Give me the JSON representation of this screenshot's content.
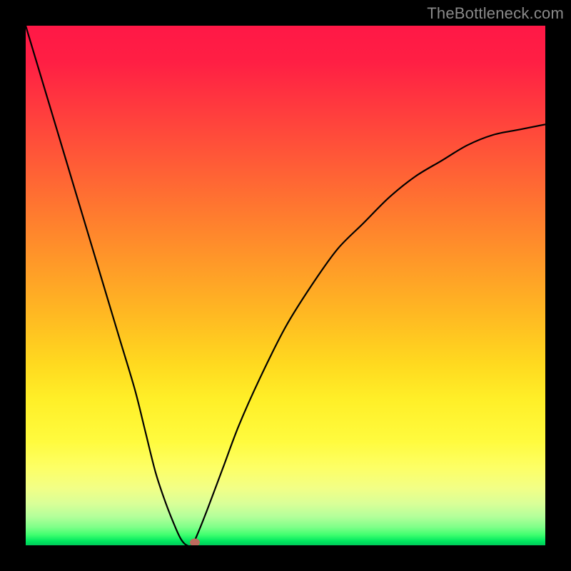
{
  "watermark": "TheBottleneck.com",
  "colors": {
    "background": "#000000",
    "curve": "#000000",
    "marker": "#bd6b5e"
  },
  "chart_data": {
    "type": "line",
    "title": "",
    "xlabel": "",
    "ylabel": "",
    "xlim": [
      0,
      100
    ],
    "ylim": [
      0,
      100
    ],
    "grid": false,
    "series": [
      {
        "name": "bottleneck-curve",
        "x": [
          0,
          3,
          6,
          9,
          12,
          15,
          18,
          21,
          23,
          25,
          27,
          29,
          30,
          31,
          32,
          33,
          35,
          38,
          41,
          45,
          50,
          55,
          60,
          65,
          70,
          75,
          80,
          85,
          90,
          95,
          100
        ],
        "values": [
          100,
          90,
          80,
          70,
          60,
          50,
          40,
          30,
          22,
          14,
          8,
          3,
          1,
          0,
          0,
          2,
          7,
          15,
          23,
          32,
          42,
          50,
          57,
          62,
          67,
          71,
          74,
          77,
          79,
          80,
          81
        ]
      }
    ],
    "marker": {
      "x": 32.5,
      "y": 0.5
    },
    "gradient_stops": [
      {
        "pos": 0.0,
        "color": "#ff1846"
      },
      {
        "pos": 0.36,
        "color": "#ff7a2f"
      },
      {
        "pos": 0.65,
        "color": "#ffd91f"
      },
      {
        "pos": 0.85,
        "color": "#fdff65"
      },
      {
        "pos": 0.96,
        "color": "#7fff89"
      },
      {
        "pos": 1.0,
        "color": "#00cb5a"
      }
    ]
  }
}
